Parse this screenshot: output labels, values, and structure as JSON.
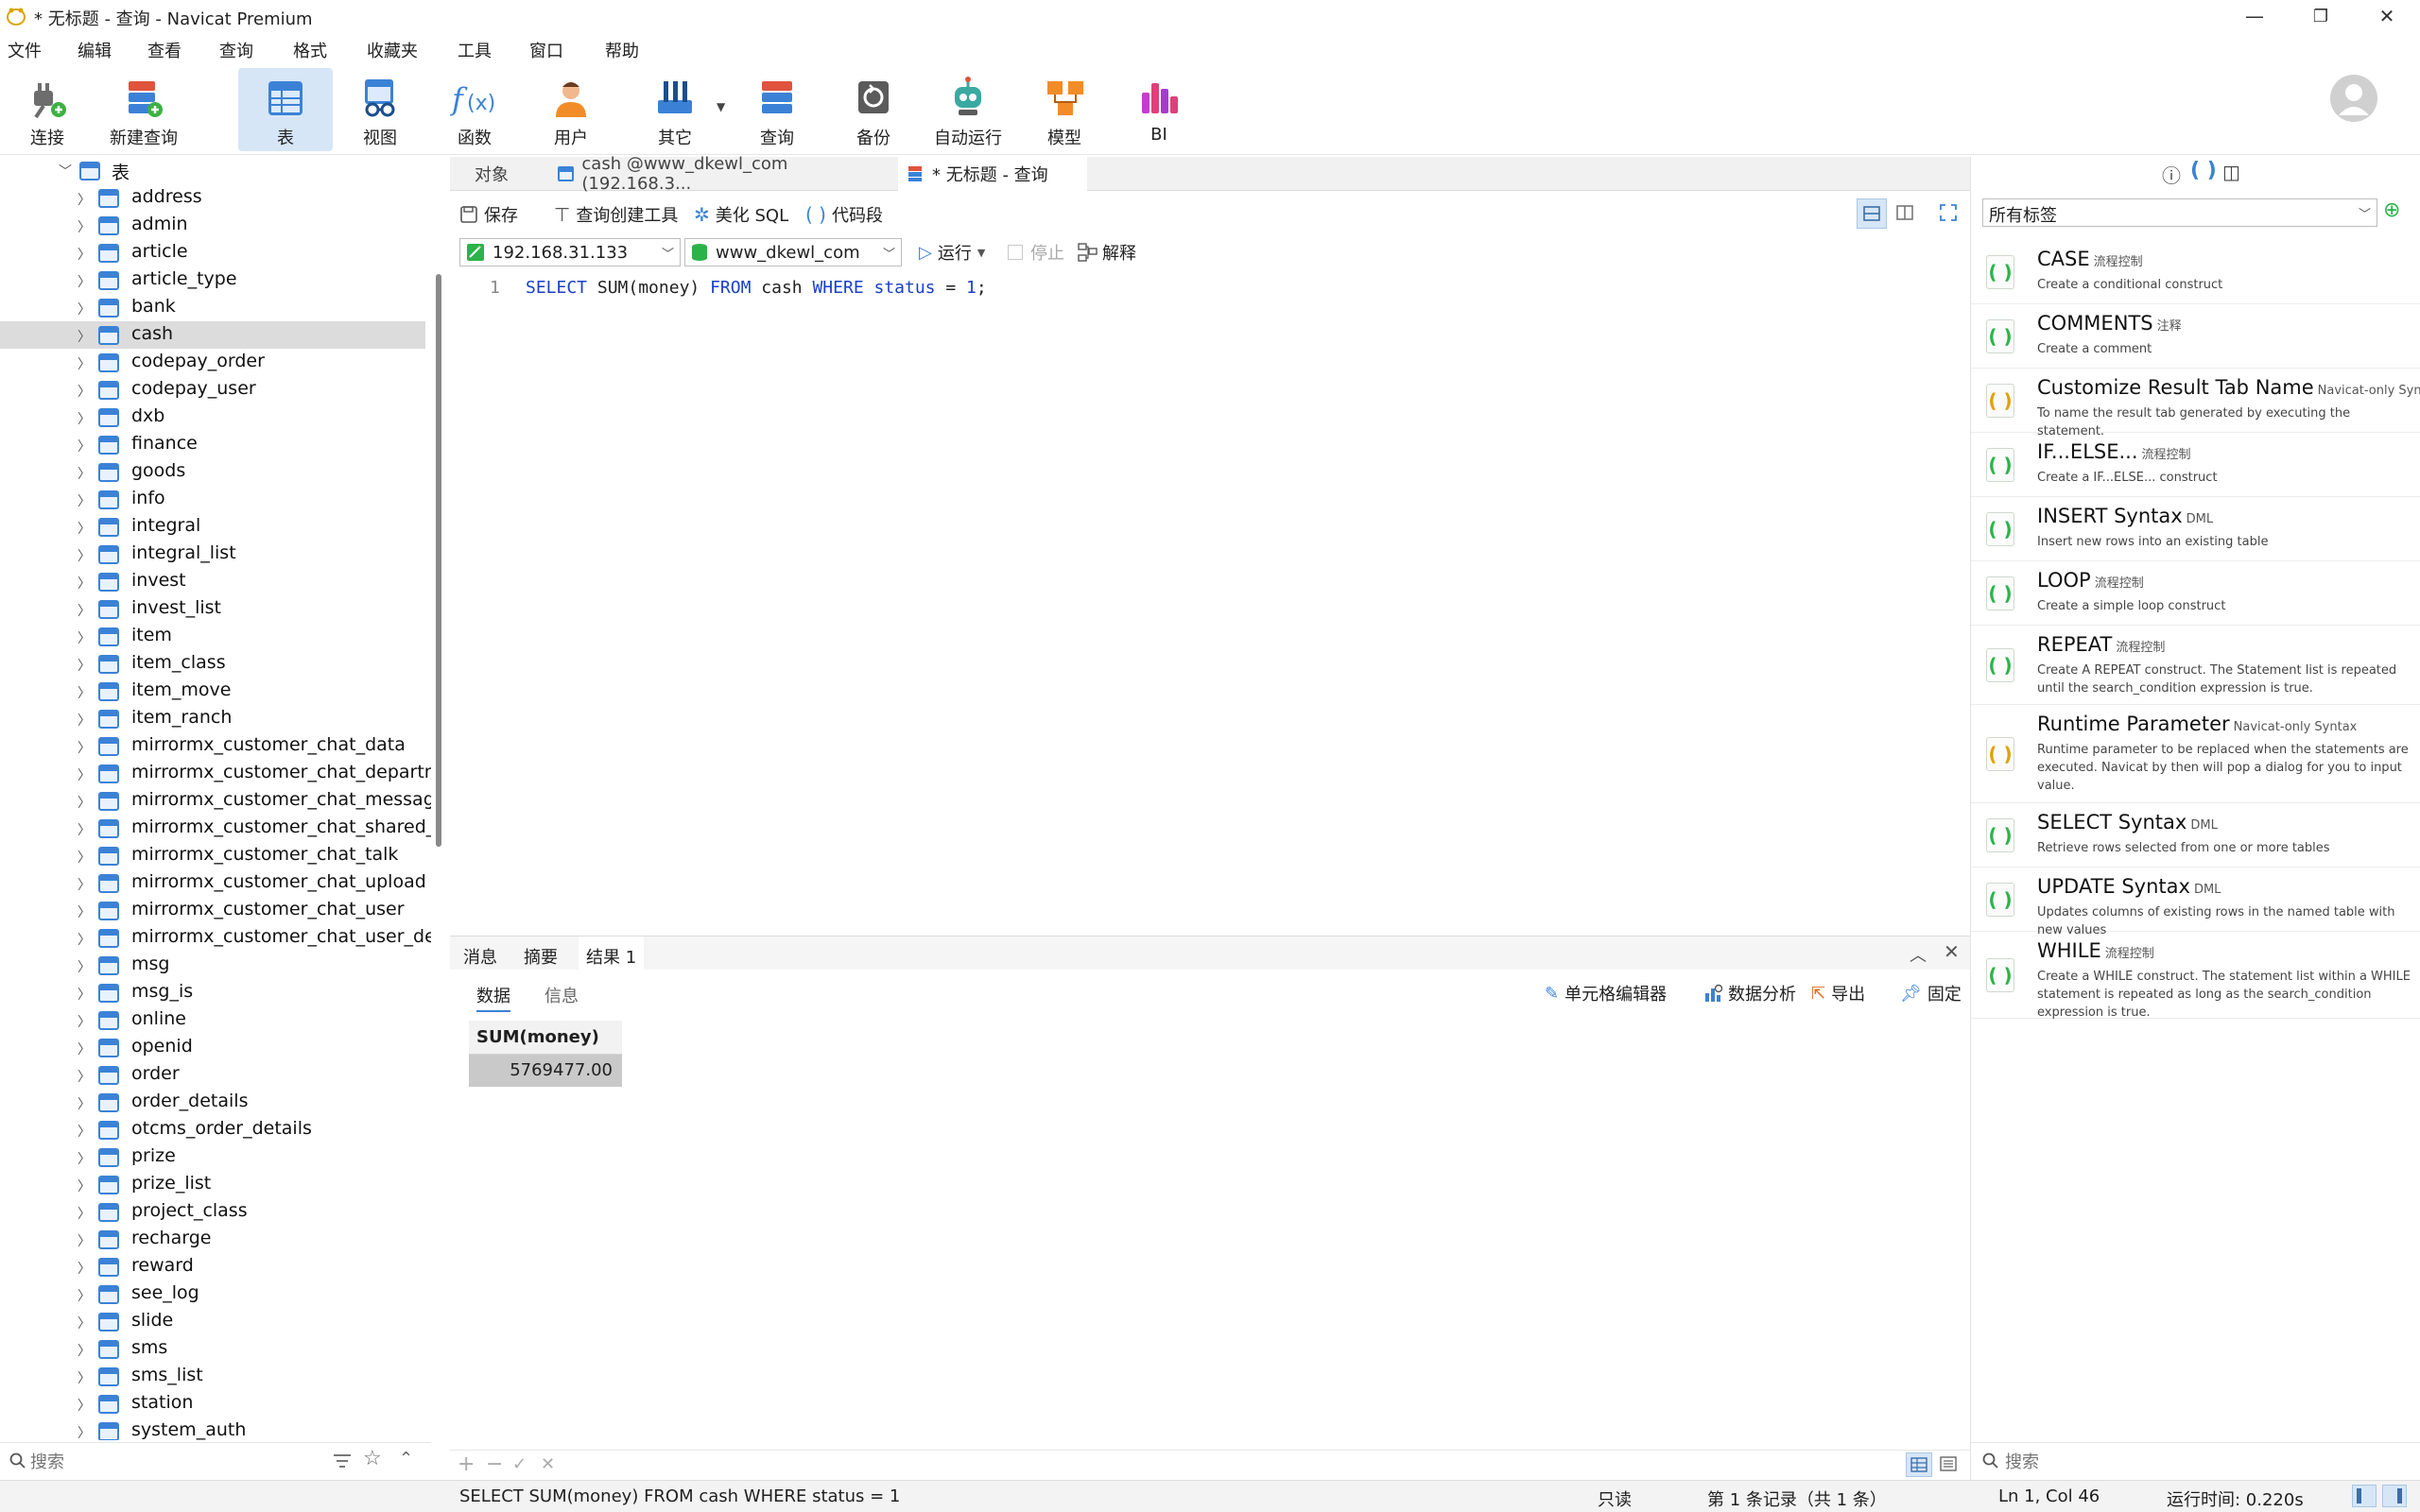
{
  "window": {
    "title": "* 无标题 - 查询 - Navicat Premium",
    "minimize": "—",
    "maximize": "❐",
    "close": "✕"
  },
  "menu": [
    "文件",
    "编辑",
    "查看",
    "查询",
    "格式",
    "收藏夹",
    "工具",
    "窗口",
    "帮助"
  ],
  "toolbar": {
    "connect": "连接",
    "new_query": "新建查询",
    "table": "表",
    "view": "视图",
    "function": "函数",
    "user": "用户",
    "other": "其它",
    "query": "查询",
    "backup": "备份",
    "autorun": "自动运行",
    "model": "模型",
    "bi": "BI"
  },
  "tree": {
    "root": "表",
    "tables": [
      "address",
      "admin",
      "article",
      "article_type",
      "bank",
      "cash",
      "codepay_order",
      "codepay_user",
      "dxb",
      "finance",
      "goods",
      "info",
      "integral",
      "integral_list",
      "invest",
      "invest_list",
      "item",
      "item_class",
      "item_move",
      "item_ranch",
      "mirrormx_customer_chat_data",
      "mirrormx_customer_chat_departmer",
      "mirrormx_customer_chat_message",
      "mirrormx_customer_chat_shared_file",
      "mirrormx_customer_chat_talk",
      "mirrormx_customer_chat_upload",
      "mirrormx_customer_chat_user",
      "mirrormx_customer_chat_user_depa",
      "msg",
      "msg_is",
      "online",
      "openid",
      "order",
      "order_details",
      "otcms_order_details",
      "prize",
      "prize_list",
      "project_class",
      "recharge",
      "reward",
      "see_log",
      "slide",
      "sms",
      "sms_list",
      "station",
      "system_auth"
    ],
    "selected": "cash",
    "search_placeholder": "搜索"
  },
  "tabs": {
    "objects": "对象",
    "cash": "cash @www_dkewl_com (192.168.3...",
    "query": "* 无标题 - 查询"
  },
  "query_tools": {
    "save": "保存",
    "builder": "查询创建工具",
    "beautify": "美化 SQL",
    "snippet": "代码段"
  },
  "connection": {
    "host": "192.168.31.133",
    "database": "www_dkewl_com",
    "run": "运行",
    "stop": "停止",
    "explain": "解释"
  },
  "editor": {
    "line_number": "1",
    "tokens": {
      "select": "SELECT",
      "func": " SUM(money) ",
      "from": "FROM",
      "table": " cash ",
      "where": "WHERE",
      "col": " status",
      "eq": " = ",
      "val": "1",
      "end": ";"
    }
  },
  "result": {
    "tabs": [
      "消息",
      "摘要",
      "结果 1"
    ],
    "sub_tabs": [
      "数据",
      "信息"
    ],
    "actions": {
      "cell_editor": "单元格编辑器",
      "analysis": "数据分析",
      "export": "导出",
      "pin": "固定"
    },
    "columns": [
      "SUM(money)"
    ],
    "rows": [
      [
        "5769477.00"
      ]
    ]
  },
  "snippets": {
    "filter": "所有标签",
    "search_placeholder": "搜索",
    "items": [
      {
        "name": "CASE",
        "tag": "流程控制",
        "desc": "Create a conditional construct",
        "icon": "green"
      },
      {
        "name": "COMMENTS",
        "tag": "注释",
        "desc": "Create a comment",
        "icon": "green"
      },
      {
        "name": "Customize Result Tab Name",
        "tag": "Navicat-only Syntax",
        "desc": "To name the result tab generated by executing the statement.",
        "icon": "yellow"
      },
      {
        "name": "IF...ELSE...",
        "tag": "流程控制",
        "desc": "Create a IF...ELSE... construct",
        "icon": "green"
      },
      {
        "name": "INSERT Syntax",
        "tag": "DML",
        "desc": "Insert new rows into an existing table",
        "icon": "green"
      },
      {
        "name": "LOOP",
        "tag": "流程控制",
        "desc": "Create a simple loop construct",
        "icon": "green"
      },
      {
        "name": "REPEAT",
        "tag": "流程控制",
        "desc": "Create A REPEAT construct. The Statement list is repeated until the search_condition expression is true.",
        "icon": "green"
      },
      {
        "name": "Runtime Parameter",
        "tag": "Navicat-only Syntax",
        "desc": "Runtime parameter to be replaced when the statements are executed. Navicat by then will pop a dialog for you to input value.",
        "icon": "yellow"
      },
      {
        "name": "SELECT Syntax",
        "tag": "DML",
        "desc": "Retrieve rows selected from one or more tables",
        "icon": "green"
      },
      {
        "name": "UPDATE Syntax",
        "tag": "DML",
        "desc": "Updates columns of existing rows in the named table with new values",
        "icon": "green"
      },
      {
        "name": "WHILE",
        "tag": "流程控制",
        "desc": "Create a WHILE construct. The statement list within a WHILE statement is repeated as long as the search_condition expression is true.",
        "icon": "green"
      }
    ]
  },
  "status": {
    "sql": "SELECT SUM(money) FROM cash WHERE status = 1",
    "readonly": "只读",
    "records": "第 1 条记录（共 1 条）",
    "position": "Ln 1, Col 46",
    "runtime": "运行时间: 0.220s"
  }
}
